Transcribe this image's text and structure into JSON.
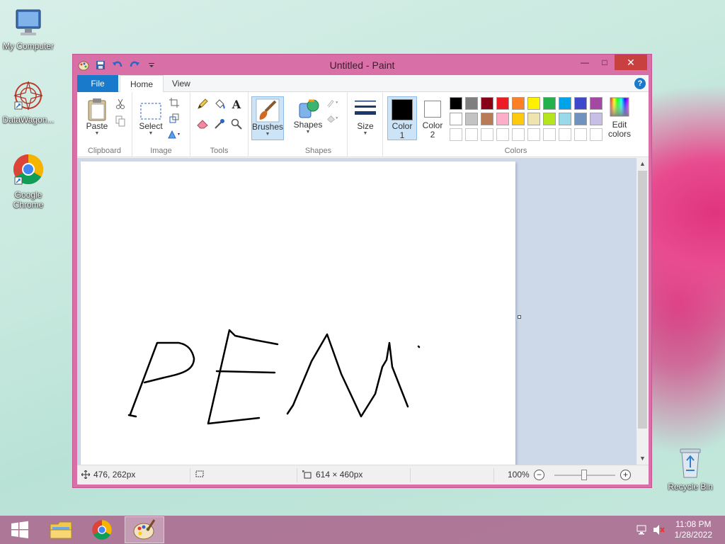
{
  "desktop": {
    "icons": [
      {
        "label": "My Computer",
        "icon": "computer-icon"
      },
      {
        "label": "DataWagon...",
        "icon": "datawagon-icon"
      },
      {
        "label": "Google Chrome",
        "icon": "chrome-icon"
      },
      {
        "label": "Recycle Bin",
        "icon": "recycle-bin-icon"
      }
    ]
  },
  "window": {
    "title": "Untitled - Paint",
    "controls": {
      "minimize": "—",
      "maximize": "□",
      "close": "✕"
    }
  },
  "ribbon": {
    "tabs": [
      "File",
      "Home",
      "View"
    ],
    "help": "?",
    "groups": {
      "clipboard": {
        "label": "Clipboard",
        "paste": "Paste"
      },
      "image": {
        "label": "Image",
        "select": "Select"
      },
      "tools": {
        "label": "Tools"
      },
      "brushes": {
        "label": "Brushes"
      },
      "shapes": {
        "label": "Shapes",
        "shapes_btn": "Shapes"
      },
      "size": {
        "label": "Size"
      },
      "colors": {
        "label": "Colors",
        "color1_line1": "Color",
        "color1_line2": "1",
        "color2_line1": "Color",
        "color2_line2": "2",
        "edit_line1": "Edit",
        "edit_line2": "colors",
        "color1_value": "#000000",
        "color2_value": "#ffffff",
        "palette_row1": [
          "#000000",
          "#7f7f7f",
          "#880015",
          "#ed1c24",
          "#ff7f27",
          "#fff200",
          "#22b14c",
          "#00a2e8",
          "#3f48cc",
          "#a349a4"
        ],
        "palette_row2": [
          "#ffffff",
          "#c3c3c3",
          "#b97a57",
          "#ffaec9",
          "#ffc90e",
          "#efe4b0",
          "#b5e61d",
          "#99d9ea",
          "#7092be",
          "#c8bfe7"
        ]
      }
    }
  },
  "status": {
    "cursor_pos": "476, 262px",
    "image_size": "614 × 460px",
    "zoom": "100%",
    "zoom_level_percent": 100
  },
  "taskbar": {
    "time": "11:08 PM",
    "date": "1/28/2022",
    "items": [
      "start-button",
      "file-explorer",
      "chrome",
      "paint"
    ]
  }
}
